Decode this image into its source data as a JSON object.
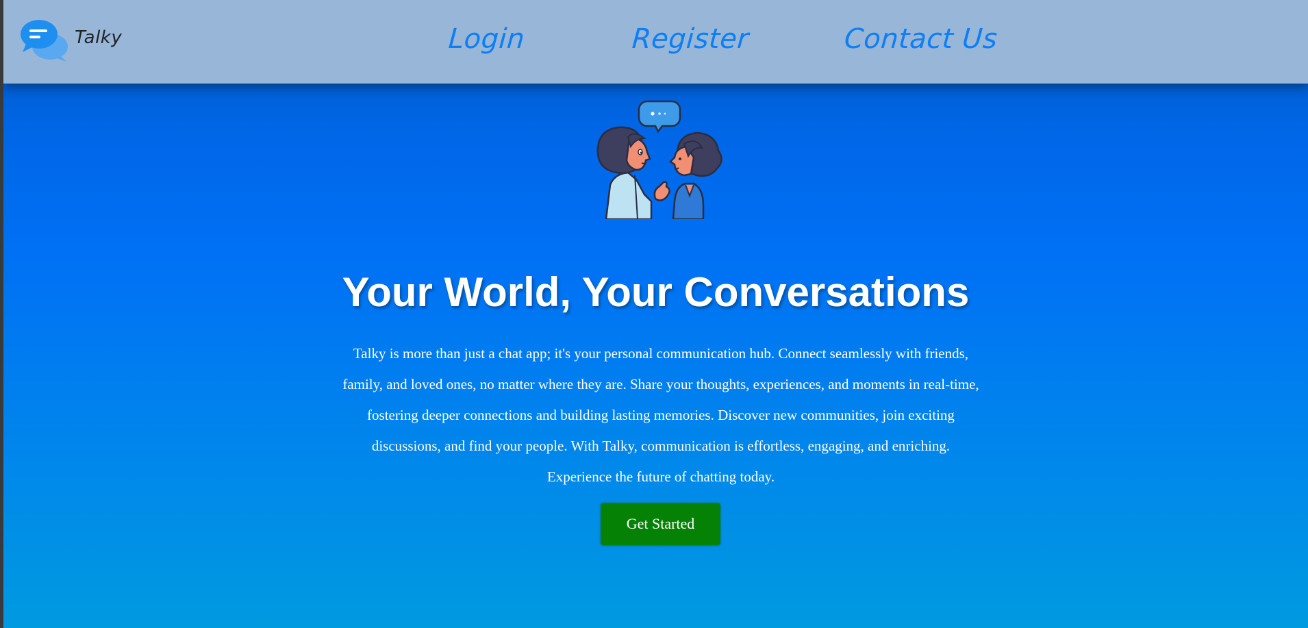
{
  "nav": {
    "brand_name": "Talky",
    "links": [
      {
        "label": "Login"
      },
      {
        "label": "Register"
      },
      {
        "label": "Contact Us"
      }
    ]
  },
  "hero": {
    "title": "Your World, Your Conversations",
    "description": "Talky is more than just a chat app; it's your personal communication hub. Connect seamlessly with friends, family, and loved ones, no matter where they are. Share your thoughts, experiences, and moments in real-time, fostering deeper connections and building lasting memories. Discover new communities, join exciting discussions, and find your people. With Talky, communication is effortless, engaging, and enriching. Experience the future of chatting today.",
    "cta_label": "Get Started"
  },
  "icons": {
    "logo": "chat-bubbles-icon",
    "illustration": "two-people-chatting-illustration"
  },
  "colors": {
    "navbar_bg": "#97b6d8",
    "nav_link": "#0c7ef6",
    "hero_gradient_top": "#0052b3",
    "hero_gradient_mid": "#0070f5",
    "hero_gradient_bottom": "#009ae0",
    "cta_bg": "#058205",
    "text": "#ffffff"
  }
}
